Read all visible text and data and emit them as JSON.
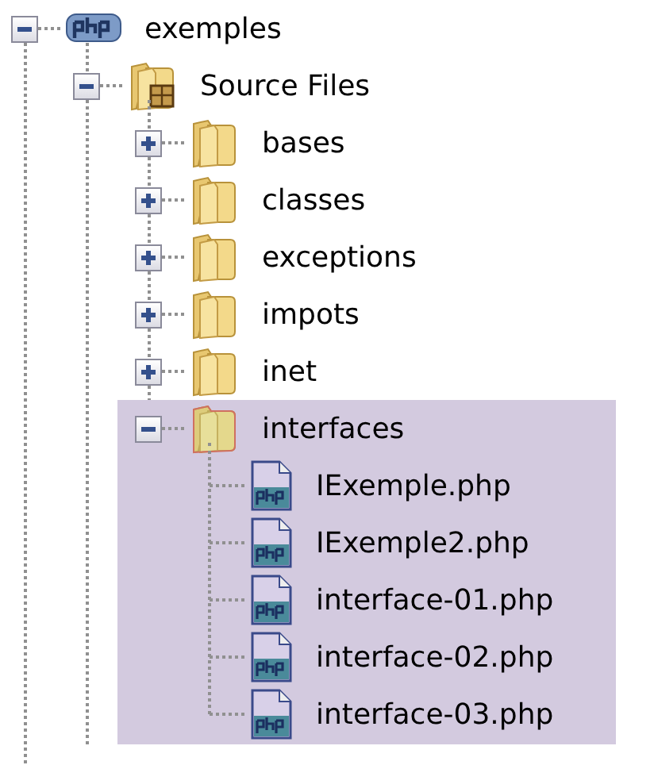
{
  "tree": [
    {
      "kind": "project",
      "label": "exemples",
      "expanded": true,
      "selected": false,
      "children": [
        {
          "kind": "source-root",
          "label": "Source Files",
          "expanded": true,
          "selected": false,
          "children": [
            {
              "kind": "folder",
              "label": "bases",
              "expanded": false,
              "selected": false
            },
            {
              "kind": "folder",
              "label": "classes",
              "expanded": false,
              "selected": false
            },
            {
              "kind": "folder",
              "label": "exceptions",
              "expanded": false,
              "selected": false
            },
            {
              "kind": "folder",
              "label": "impots",
              "expanded": false,
              "selected": false
            },
            {
              "kind": "folder",
              "label": "inet",
              "expanded": false,
              "selected": false
            },
            {
              "kind": "folder",
              "label": "interfaces",
              "expanded": true,
              "selected": true,
              "children": [
                {
                  "kind": "file",
                  "label": "IExemple.php",
                  "selected": false
                },
                {
                  "kind": "file",
                  "label": "IExemple2.php",
                  "selected": false
                },
                {
                  "kind": "file",
                  "label": "interface-01.php",
                  "selected": false
                },
                {
                  "kind": "file",
                  "label": "interface-02.php",
                  "selected": false
                },
                {
                  "kind": "file",
                  "label": "interface-03.php",
                  "selected": false
                }
              ]
            }
          ]
        }
      ]
    }
  ]
}
